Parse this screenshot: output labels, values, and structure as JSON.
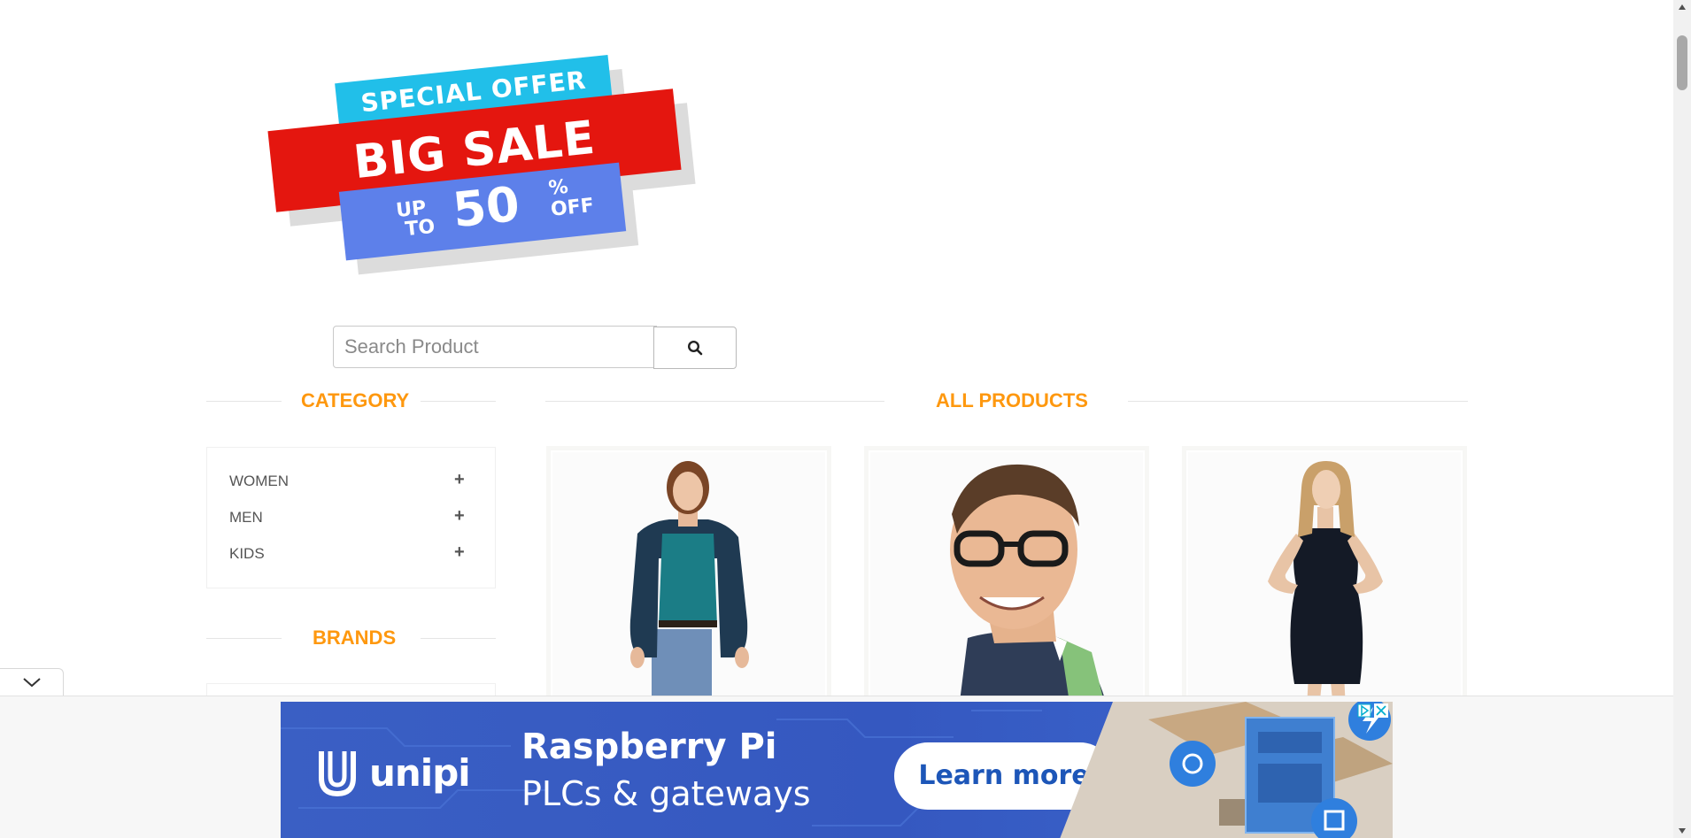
{
  "promo": {
    "line1": "SPECIAL OFFER",
    "line2": "BIG SALE",
    "up": "UP",
    "to": "TO",
    "percent": "50",
    "pct_sign": "%",
    "off": "OFF"
  },
  "search": {
    "placeholder": "Search Product",
    "button_icon": "search-icon"
  },
  "sidebar": {
    "category_title": "CATEGORY",
    "categories": [
      {
        "label": "WOMEN",
        "icon": "plus-icon"
      },
      {
        "label": "MEN",
        "icon": "plus-icon"
      },
      {
        "label": "KIDS",
        "icon": "plus-icon"
      }
    ],
    "brands_title": "BRANDS"
  },
  "main": {
    "title": "ALL PRODUCTS",
    "products": [
      {
        "image": "woman-in-cardigan"
      },
      {
        "image": "man-in-glasses"
      },
      {
        "image": "woman-in-black-dress"
      }
    ]
  },
  "ad": {
    "brand": "unipi",
    "headline": "Raspberry Pi",
    "subline": "PLCs & gateways",
    "cta": "Learn more"
  },
  "colors": {
    "accent": "#fe980f",
    "ad_blue": "#3558c0"
  }
}
